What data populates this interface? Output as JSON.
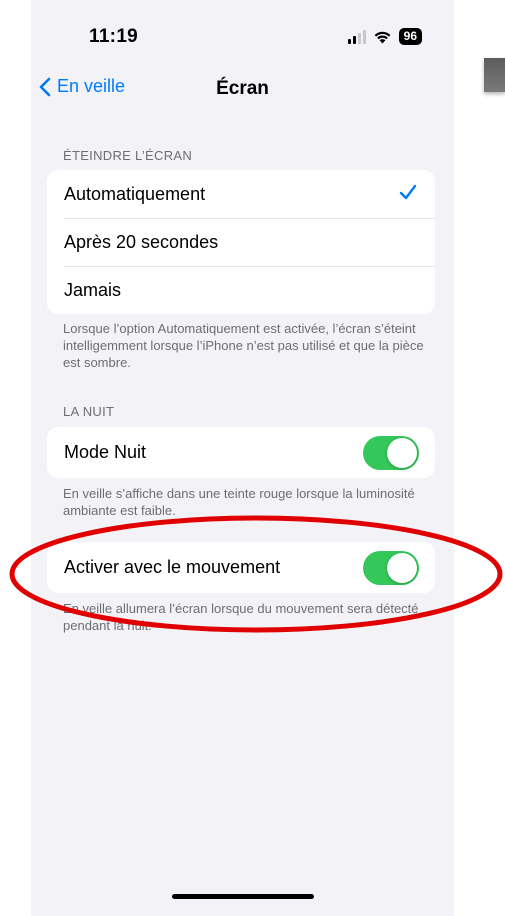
{
  "status_bar": {
    "time": "11:19",
    "battery": "96"
  },
  "nav": {
    "back_label": "En veille",
    "title": "Écran"
  },
  "sections": {
    "turn_off": {
      "header": "ÉTEINDRE L’ÉCRAN",
      "options": [
        "Automatiquement",
        "Après 20 secondes",
        "Jamais"
      ],
      "selected": "Automatiquement",
      "footer": "Lorsque l’option Automatiquement est activée, l’écran s’éteint intelligemment lorsque l’iPhone n’est pas utilisé et que la pièce est sombre."
    },
    "night": {
      "header": "LA NUIT",
      "mode_label": "Mode Nuit",
      "mode_on": true,
      "mode_footer": "En veille s’affiche dans une teinte rouge lorsque la luminosité ambiante est faible.",
      "motion_label": "Activer avec le mouvement",
      "motion_on": true,
      "motion_footer": "En veille allumera l’écran lorsque du mouvement sera détecté pendant la nuit."
    }
  },
  "colors": {
    "accent": "#007aff",
    "toggle_on": "#34c759",
    "annotation": "#e00000",
    "background": "#f2f2f7"
  },
  "icons": [
    "chevron-left-icon",
    "checkmark-icon",
    "signal-icon",
    "wifi-icon",
    "battery-icon"
  ]
}
